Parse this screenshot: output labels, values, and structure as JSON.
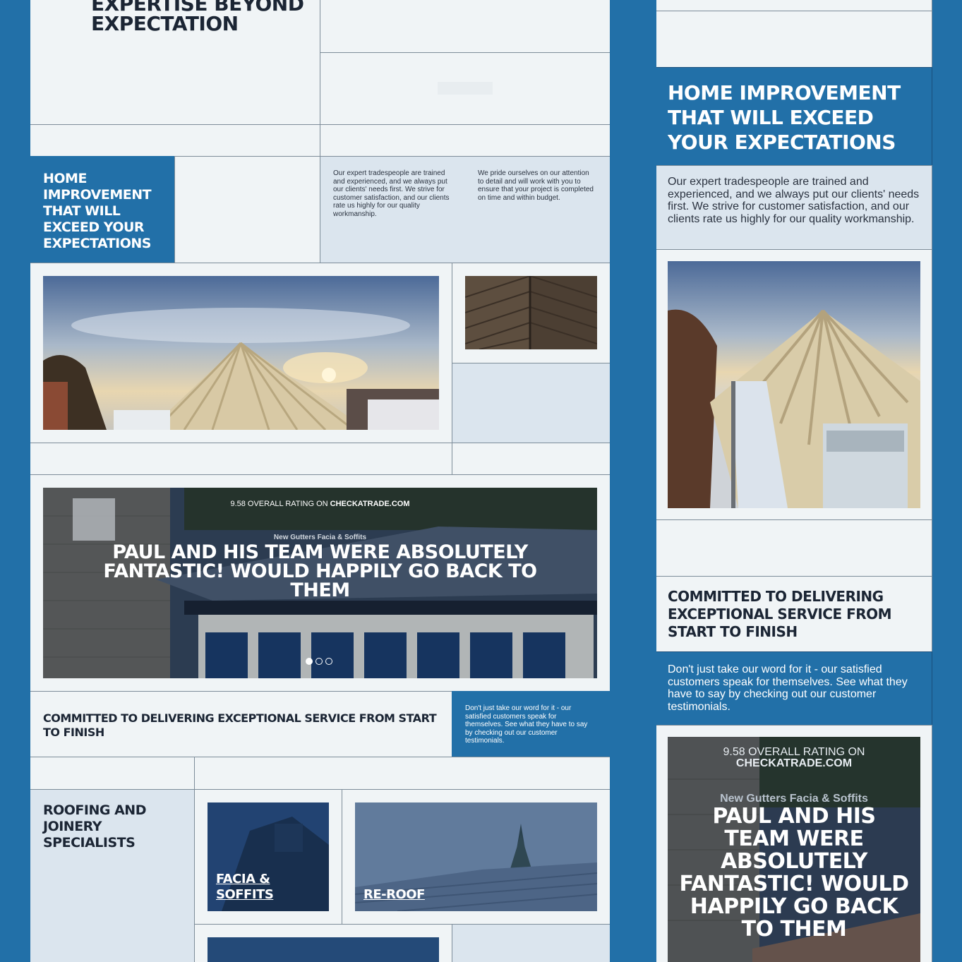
{
  "colors": {
    "brand_blue": "#2270a8",
    "panel_bg": "#f0f4f6",
    "light_blue": "#dbe5ee",
    "ink": "#1b2534"
  },
  "desktop": {
    "hero_title": "EXPERTISE BEYOND EXPECTATION",
    "intro_title": "HOME IMPROVEMENT THAT WILL EXCEED YOUR EXPECTATIONS",
    "intro_text_1": "Our expert tradespeople are trained and experienced, and we always put our clients' needs first. We strive for customer satisfaction, and our clients rate us highly for our quality workmanship.",
    "intro_text_2": "We pride ourselves on our attention to detail and will work with you to ensure that your project is completed on time and within budget.",
    "testimonial": {
      "rating_prefix": "9.58 OVERALL RATING ON",
      "rating_site": "CHECKATRADE.COM",
      "service": "New Gutters Facia & Soffits",
      "quote": "PAUL AND HIS TEAM WERE ABSOLUTELY FANTASTIC! WOULD HAPPILY GO BACK TO THEM"
    },
    "committed_title": "COMMITTED TO DELIVERING EXCEPTIONAL SERVICE FROM START TO FINISH",
    "committed_text": "Don't just take our word for it - our satisfied customers speak for themselves. See what they have to say by checking out our customer testimonials.",
    "services_title": "ROOFING AND JOINERY SPECIALISTS",
    "service_1": "FACIA & SOFFITS",
    "service_2": "RE-ROOF"
  },
  "mobile": {
    "intro_title": "HOME IMPROVEMENT THAT WILL EXCEED YOUR EXPECTATIONS",
    "intro_text": "Our expert tradespeople are trained and experienced, and we always put our clients' needs first. We strive for customer satisfaction, and our clients rate us highly for our quality workmanship.",
    "committed_title": "COMMITTED TO DELIVERING EXCEPTIONAL SERVICE FROM START TO FINISH",
    "committed_text": "Don't just take our word for it - our satisfied customers speak for themselves. See what they have to say by checking out our customer testimonials.",
    "testimonial": {
      "rating_prefix": "9.58 OVERALL RATING ON",
      "rating_site": "CHECKATRADE.COM",
      "service": "New Gutters Facia & Soffits",
      "quote": "PAUL AND HIS TEAM WERE ABSOLUTELY FANTASTIC! WOULD HAPPILY GO BACK TO THEM"
    }
  }
}
